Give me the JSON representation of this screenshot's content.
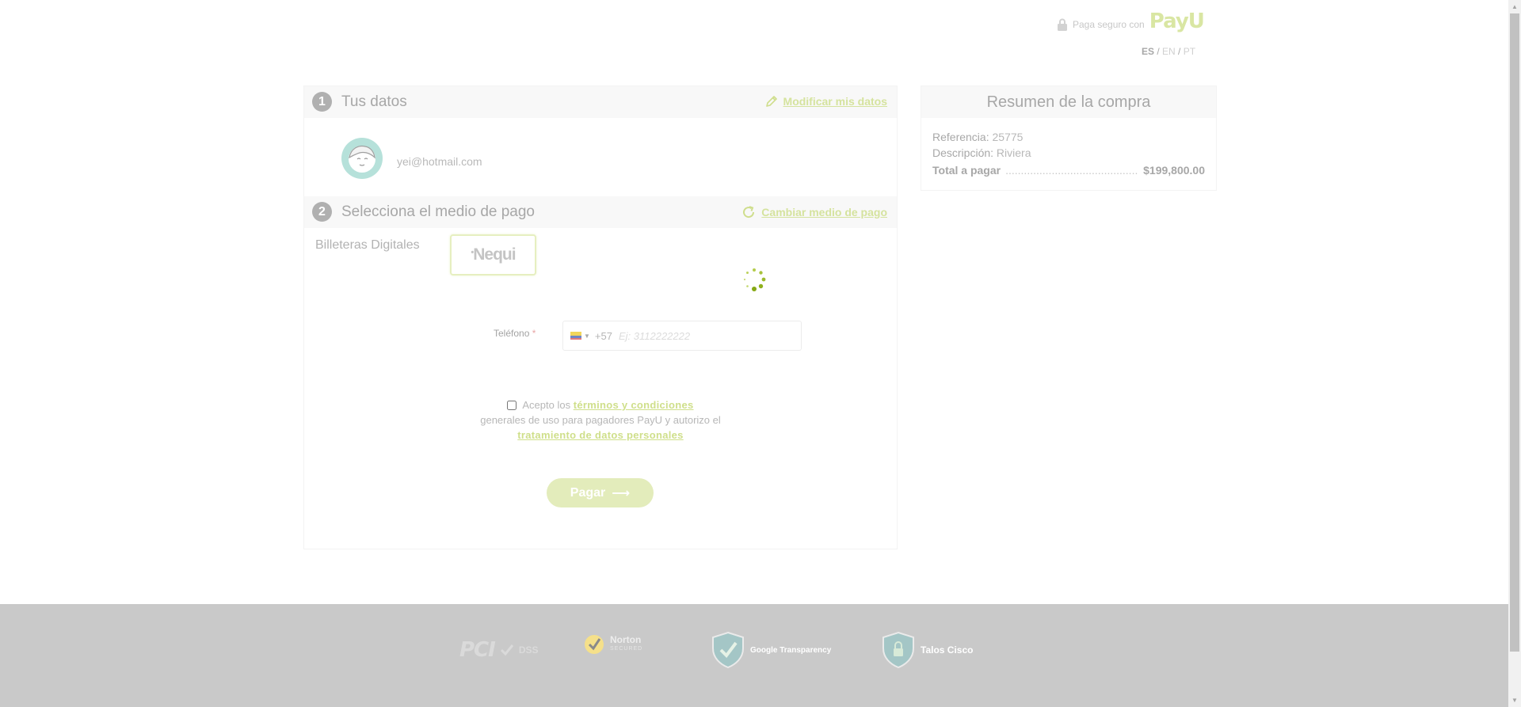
{
  "header": {
    "secure_text": "Paga seguro con",
    "brand": "PayU",
    "languages": [
      {
        "code": "ES",
        "active": true
      },
      {
        "code": "EN",
        "active": false
      },
      {
        "code": "PT",
        "active": false
      }
    ]
  },
  "step1": {
    "number": "1",
    "title": "Tus datos",
    "link_label": "Modificar mis datos",
    "link_icon": "pencil-icon",
    "email": "yei@hotmail.com"
  },
  "step2": {
    "number": "2",
    "title": "Selecciona el medio de pago",
    "link_label": "Cambiar medio de pago",
    "link_icon": "refresh-icon",
    "wallets_label": "Billeteras Digitales",
    "selected_wallet": "Nequi",
    "phone": {
      "label": "Teléfono",
      "required_mark": "*",
      "dial_code": "+57",
      "placeholder": "Ej: 3112222222",
      "value": ""
    },
    "terms": {
      "prefix": "Acepto los",
      "link1": "términos y condiciones",
      "middle": "generales de uso para pagadores PayU y autorizo el",
      "link2": "tratamiento de datos personales",
      "checked": false
    },
    "pay_button": "Pagar",
    "pay_arrow": "⟶"
  },
  "summary": {
    "title": "Resumen de la compra",
    "reference_label": "Referencia:",
    "reference": "25775",
    "description_label": "Descripción:",
    "description": "Riviera",
    "total_label": "Total a pagar",
    "total_dots": "..............................................................",
    "total": "$199,800.00"
  },
  "footer": {
    "pci": {
      "big": "PCI",
      "small": "DSS"
    },
    "norton": {
      "name": "Norton",
      "tag": "SECURED"
    },
    "google": "Google Transparency",
    "talos": "Talos Cisco"
  },
  "colors": {
    "accent": "#c8da74",
    "footer_bg": "#c9c9c9"
  }
}
